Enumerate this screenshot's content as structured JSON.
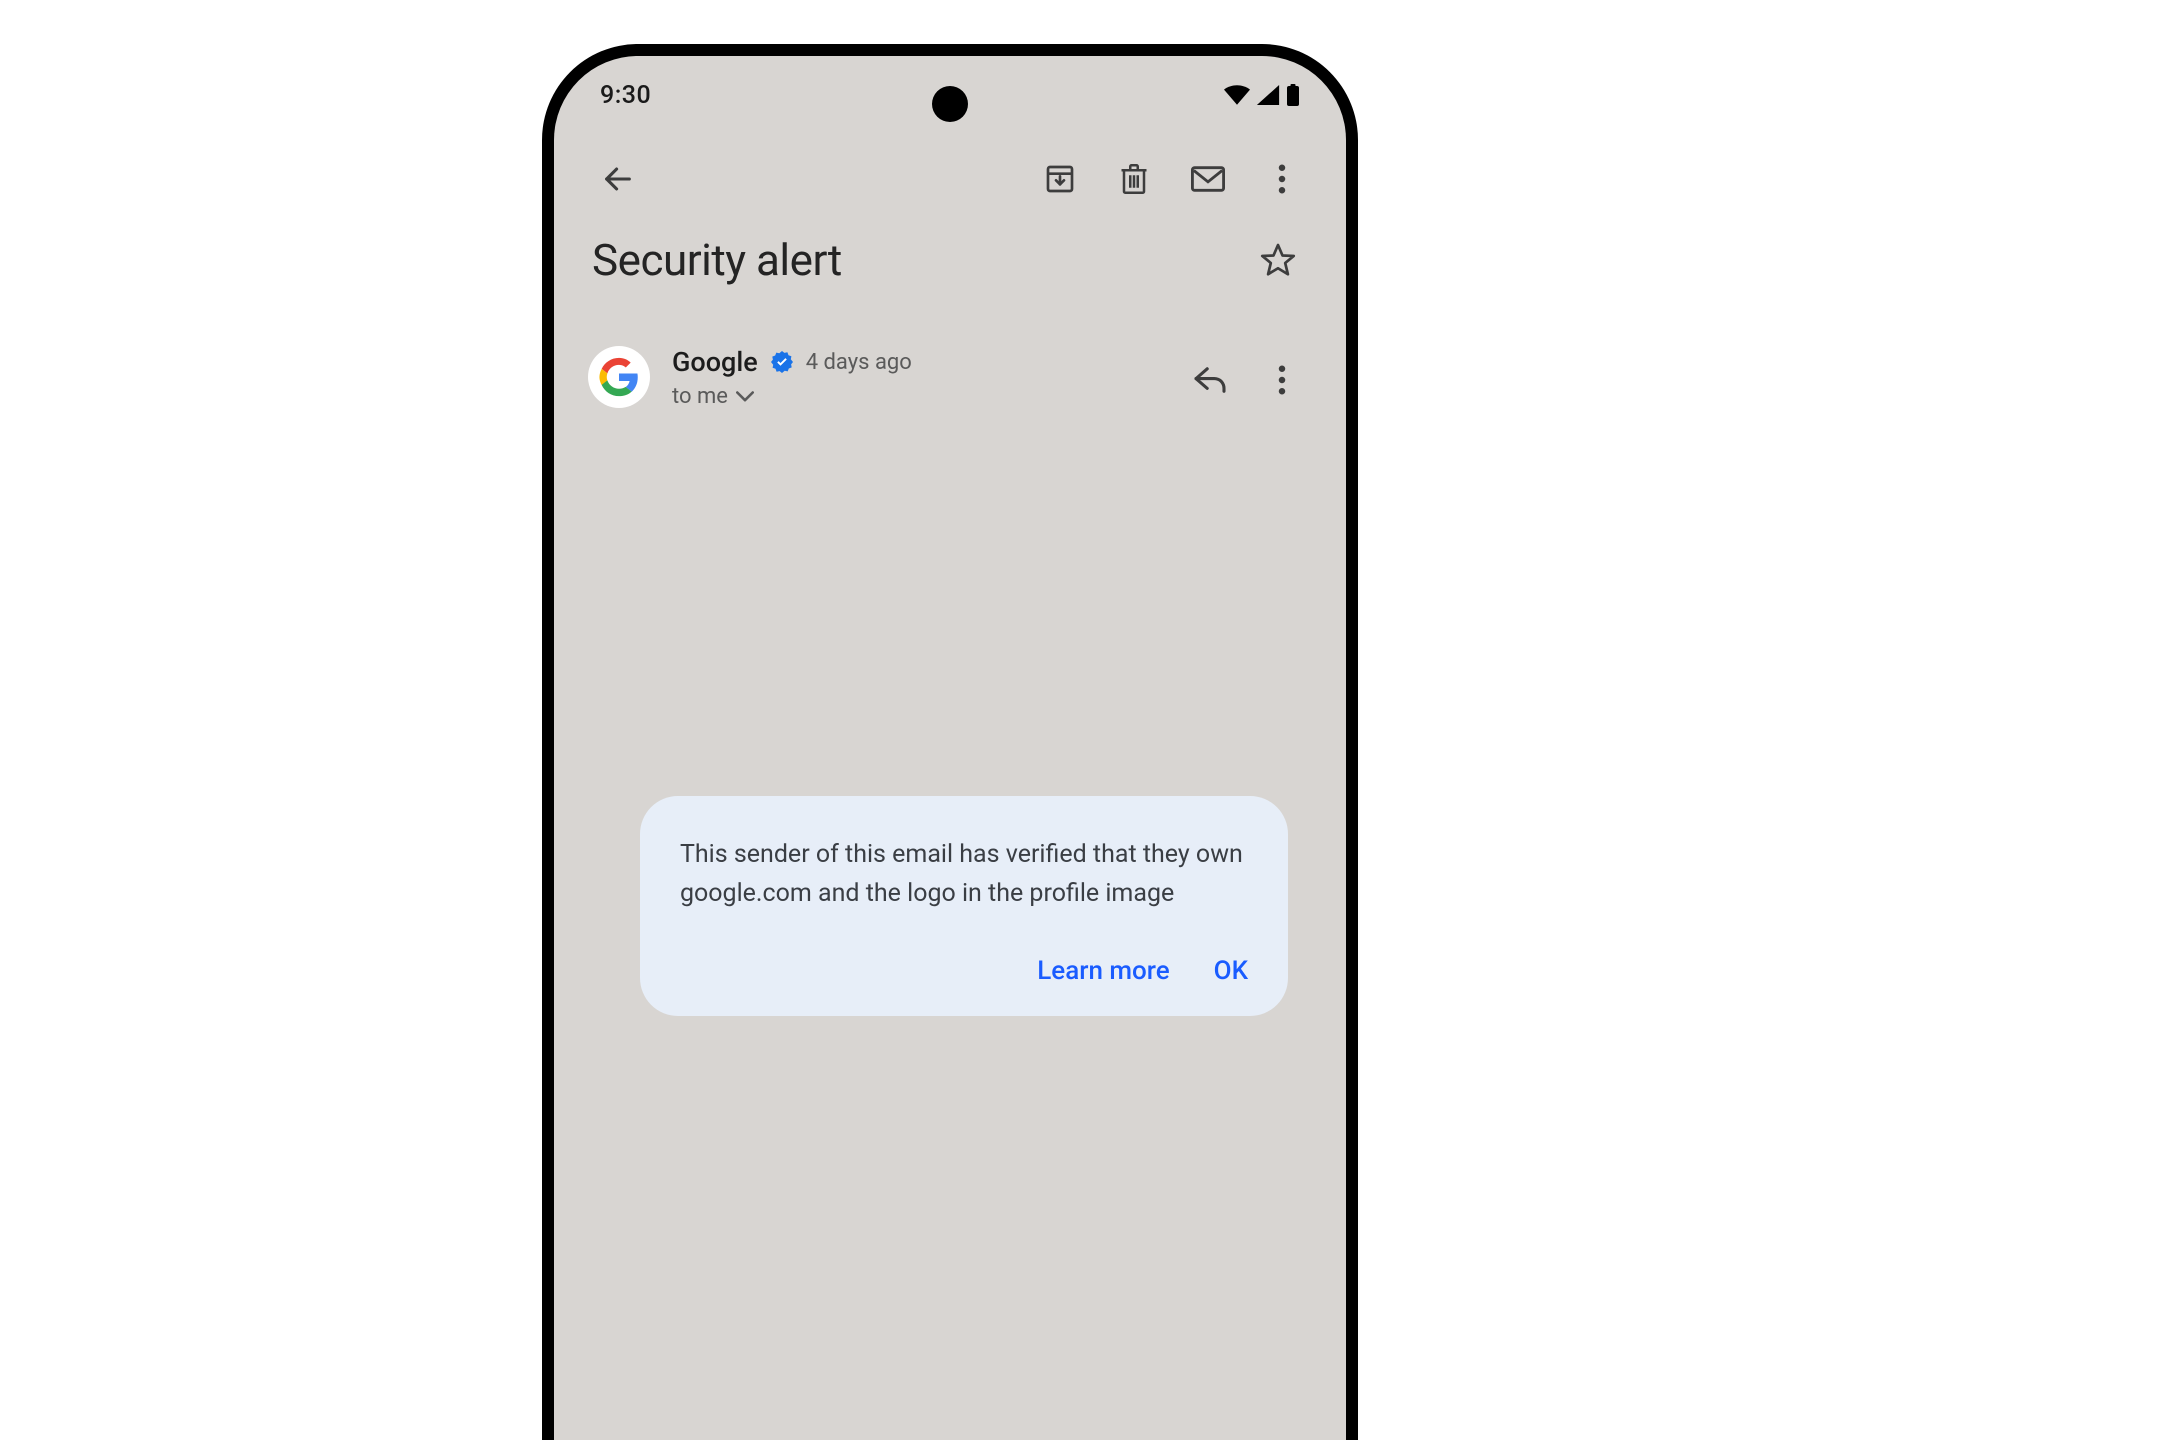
{
  "status": {
    "time": "9:30"
  },
  "email": {
    "subject": "Security alert",
    "sender_name": "Google",
    "date": "4 days ago",
    "recipient": "to me"
  },
  "popover": {
    "text_prefix": "This sender of this email has verified that they own ",
    "domain": "google.com",
    "text_suffix": " and the logo in the profile image",
    "learn_more": "Learn more",
    "ok": "OK"
  }
}
